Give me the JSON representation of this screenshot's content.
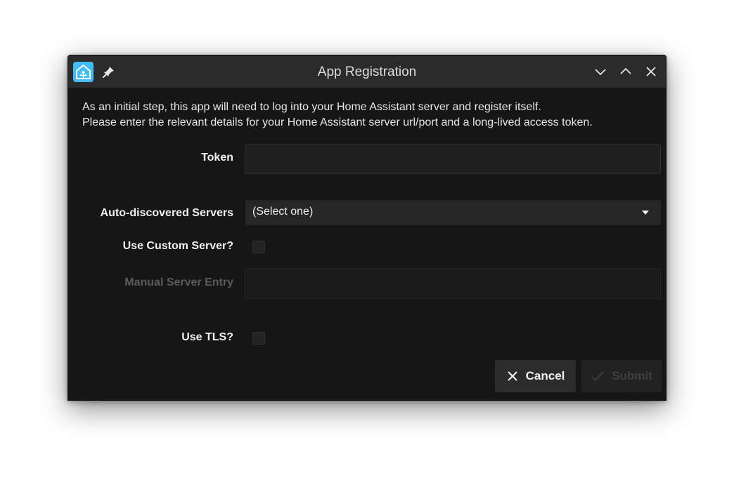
{
  "window": {
    "title": "App Registration",
    "controls": [
      "chevron-down-icon",
      "chevron-up-icon",
      "close-icon"
    ]
  },
  "intro": {
    "line1": "As an initial step, this app will need to log into your Home Assistant server and register itself.",
    "line2": "Please enter the relevant details for your Home Assistant server url/port and a long-lived access token."
  },
  "form": {
    "token_label": "Token",
    "token_value": "",
    "auto_label": "Auto-discovered Servers",
    "auto_selected": "(Select one)",
    "custom_label": "Use Custom Server?",
    "custom_checked": false,
    "manual_label": "Manual Server Entry",
    "manual_value": "",
    "tls_label": "Use TLS?",
    "tls_checked": false
  },
  "buttons": {
    "cancel_label": "Cancel",
    "submit_label": "Submit"
  },
  "colors": {
    "background": "#161616",
    "titlebar": "#2b2b2b",
    "app_icon": "#41bdf5",
    "text": "#e6e6e6",
    "disabled_text": "#5a5a5a"
  }
}
